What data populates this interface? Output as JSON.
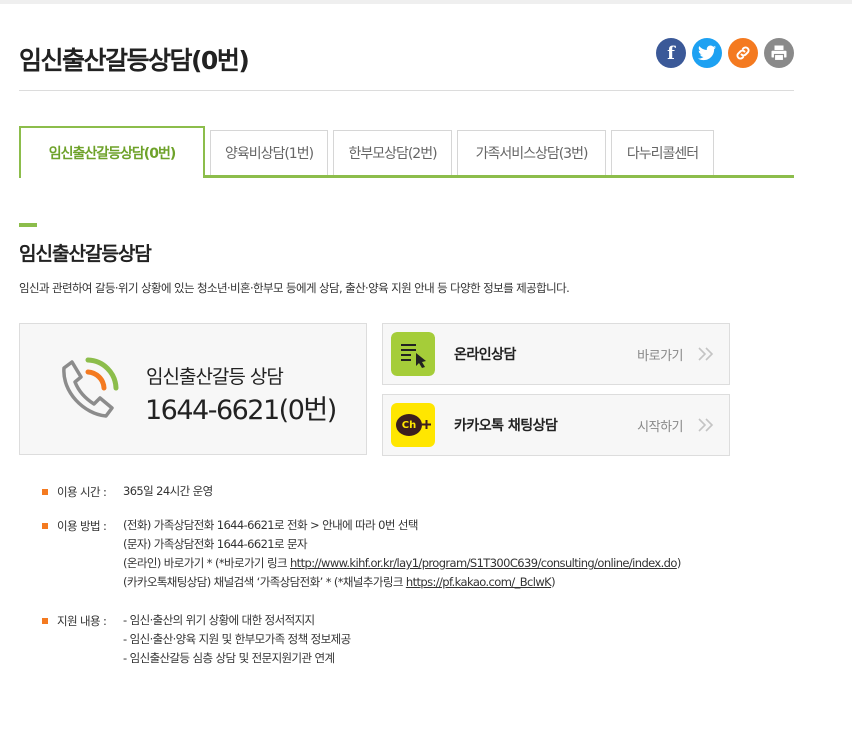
{
  "page": {
    "title": "임신출산갈등상담(0번)"
  },
  "share": {
    "facebook_glyph": "f",
    "items": [
      "facebook-icon",
      "twitter-icon",
      "link-icon",
      "print-icon"
    ]
  },
  "tabs": [
    {
      "label": "임신출산갈등상담(0번)",
      "active": true
    },
    {
      "label": "양육비상담(1번)",
      "active": false
    },
    {
      "label": "한부모상담(2번)",
      "active": false
    },
    {
      "label": "가족서비스상담(3번)",
      "active": false
    },
    {
      "label": "다누리콜센터",
      "active": false
    }
  ],
  "section": {
    "title": "임신출산갈등상담",
    "description": "임신과 관련하여 갈등·위기 상황에 있는 청소년·비혼·한부모 등에게 상담, 출산·양육 지원 안내 등 다양한 정보를 제공합니다."
  },
  "phone_box": {
    "label": "임신출산갈등 상담",
    "number": "1644-6621(0번)"
  },
  "options": [
    {
      "label": "온라인상담",
      "action": "바로가기",
      "icon": "online-form-icon"
    },
    {
      "label": "카카오톡 채팅상담",
      "action": "시작하기",
      "icon": "kakao-channel-icon",
      "icon_text": "Ch"
    }
  ],
  "info": {
    "hours": {
      "label": "이용 시간 :",
      "value": "365일 24시간 운영"
    },
    "method": {
      "label": "이용 방법 :",
      "line1": "(전화) 가족상담전화 1644-6621로 전화 > 안내에 따라 0번 선택",
      "line2": "(문자) 가족상담전화 1644-6621로 문자",
      "line3_prefix": "(온라인) 바로가기 * (*바로가기 링크 ",
      "line3_link": "http://www.kihf.or.kr/lay1/program/S1T300C639/consulting/online/index.do",
      "line3_suffix": ")",
      "line4_prefix": "(카카오톡채팅상담) 채널검색 ‘가족상담전화’ * (*채널추가링크 ",
      "line4_link": "https://pf.kakao.com/_BclwK",
      "line4_suffix": ")"
    },
    "support": {
      "label": "지원 내용 :",
      "line1": "- 임신·출산의 위기 상황에 대한 정서적지지",
      "line2": "- 임신·출산·양육 지원 및 한부모가족 정책 정보제공",
      "line3": "- 임신출산갈등 심층 상담 및 전문지원기관 연계"
    }
  },
  "colors": {
    "accent_green": "#8cbd4b",
    "accent_orange": "#f47a20",
    "facebook": "#3b5998",
    "twitter": "#1da1f2",
    "kakao_yellow": "#ffe600",
    "online_green": "#a5cd39"
  }
}
